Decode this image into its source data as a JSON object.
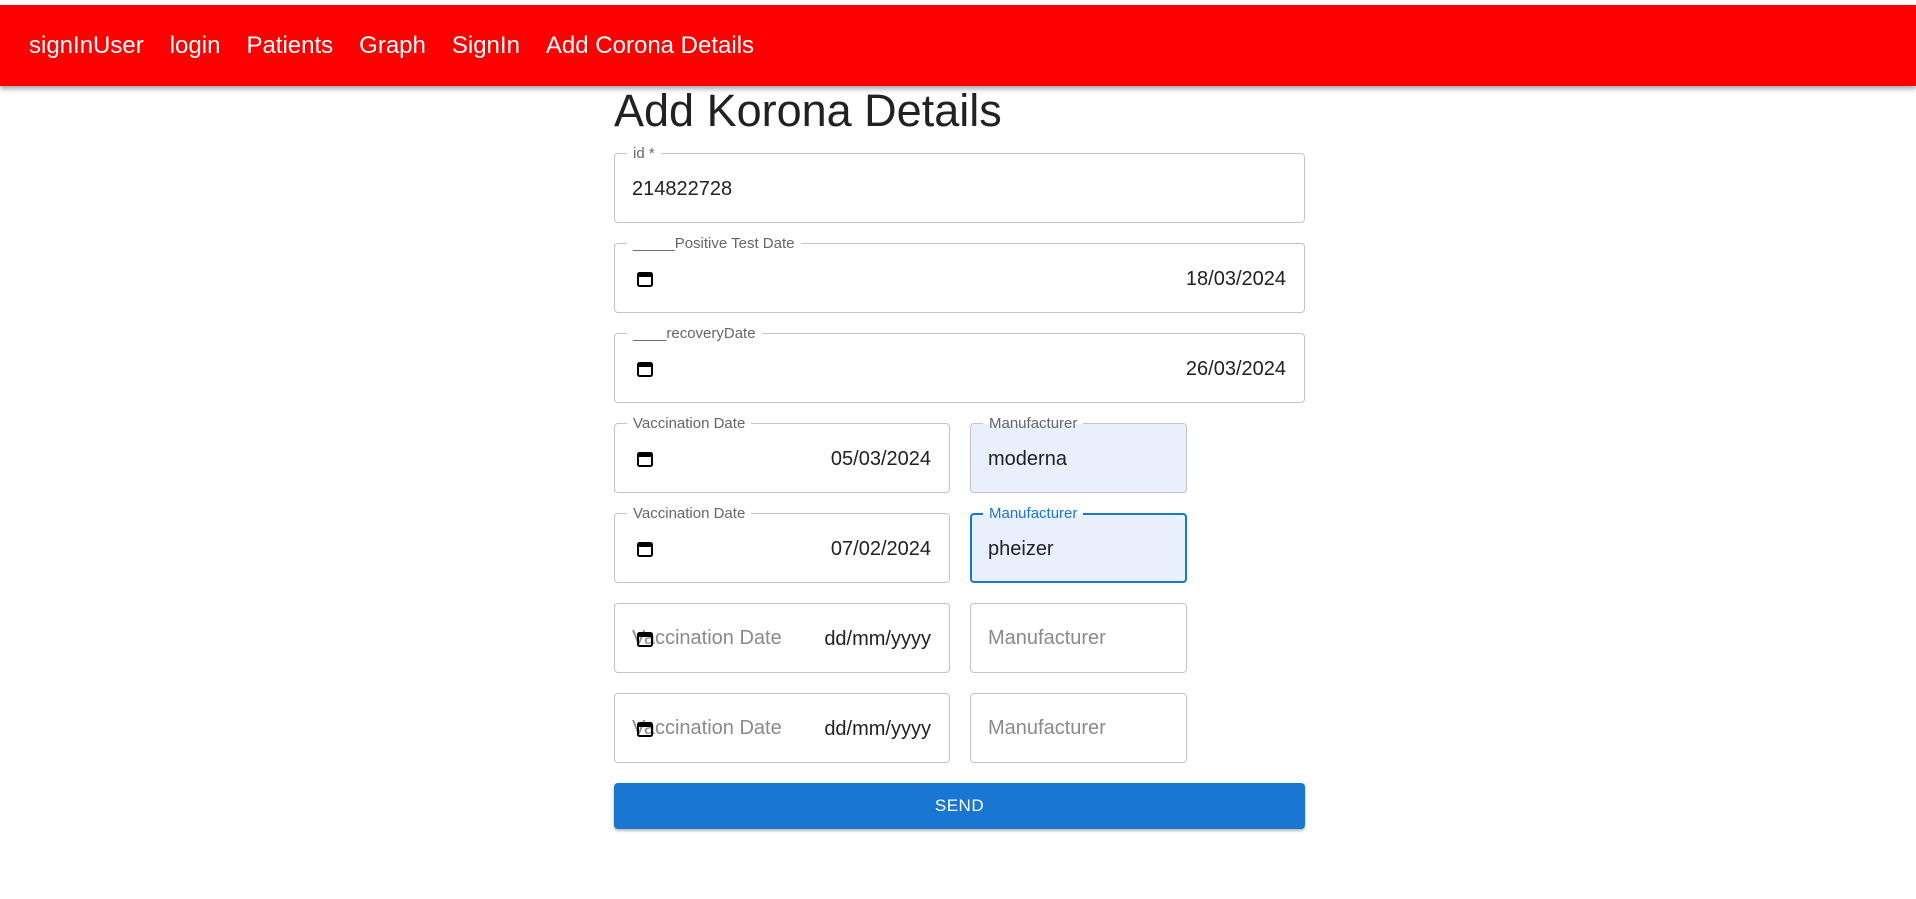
{
  "nav": {
    "items": [
      {
        "label": "signInUser"
      },
      {
        "label": "login"
      },
      {
        "label": "Patients"
      },
      {
        "label": "Graph"
      },
      {
        "label": "SignIn"
      },
      {
        "label": "Add Corona Details"
      }
    ]
  },
  "page": {
    "title": "Add Korona Details"
  },
  "form": {
    "id": {
      "label": "id *",
      "value": "214822728"
    },
    "positive_test_date": {
      "label": "_____Positive Test Date",
      "value": "18/03/2024",
      "icon": "calendar-icon"
    },
    "recovery_date": {
      "label": "____recoveryDate",
      "value": "26/03/2024",
      "icon": "calendar-icon"
    },
    "vaccinations": [
      {
        "date_label": "Vaccination Date",
        "date_value": "05/03/2024",
        "manufacturer_label": "Manufacturer",
        "manufacturer_value": "moderna"
      },
      {
        "date_label": "Vaccination Date",
        "date_value": "07/02/2024",
        "manufacturer_label": "Manufacturer",
        "manufacturer_value": "pheizer"
      },
      {
        "date_placeholder": "Vaccination Date",
        "date_value": "dd/mm/yyyy",
        "manufacturer_placeholder": "Manufacturer"
      },
      {
        "date_placeholder": "Vaccination Date",
        "date_value": "dd/mm/yyyy",
        "manufacturer_placeholder": "Manufacturer"
      }
    ],
    "send_label": "SEND"
  },
  "colors": {
    "appbar": "#ff0000",
    "primary": "#1976d2",
    "autofill": "#e8f0fe"
  }
}
